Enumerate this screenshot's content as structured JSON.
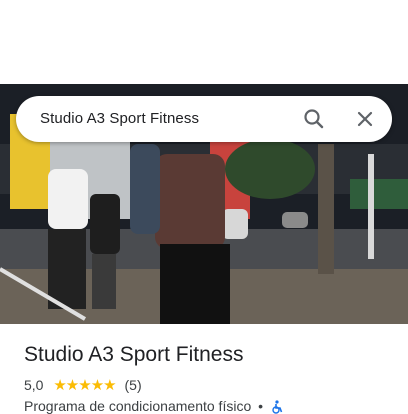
{
  "search": {
    "query": "Studio A3 Sport Fitness"
  },
  "place": {
    "name": "Studio A3 Sport Fitness",
    "rating": "5,0",
    "stars": "★★★★★",
    "review_count": "(5)",
    "category": "Programa de condicionamento físico",
    "separator": "•"
  },
  "icons": [
    "search-icon",
    "close-icon",
    "wheelchair-icon"
  ],
  "colors": {
    "star": "#fbbc04",
    "text": "#202124",
    "secondary": "#3c4043"
  }
}
